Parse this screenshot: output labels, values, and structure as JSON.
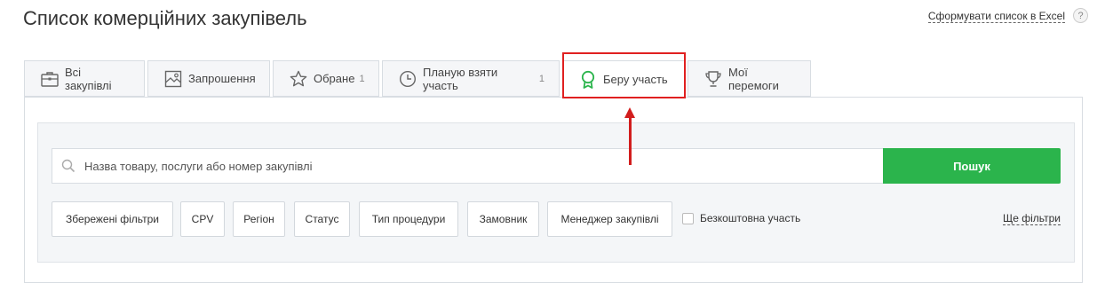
{
  "header": {
    "title": "Список комерційних закупівель",
    "excel_link": "Сформувати список в Excel",
    "help": "?"
  },
  "tabs": [
    {
      "label": "Всі закупівлі",
      "count": "",
      "icon": "briefcase-icon"
    },
    {
      "label": "Запрошення",
      "count": "",
      "icon": "envelope-icon"
    },
    {
      "label": "Обране",
      "count": "1",
      "icon": "star-icon"
    },
    {
      "label": "Планую взяти участь",
      "count": "1",
      "icon": "clock-icon"
    },
    {
      "label": "Беру участь",
      "count": "",
      "icon": "ribbon-badge-icon",
      "active": true
    },
    {
      "label": "Мої перемоги",
      "count": "",
      "icon": "trophy-icon"
    }
  ],
  "search": {
    "placeholder": "Назва товару, послуги або номер закупівлі",
    "value": "",
    "button": "Пошук"
  },
  "filters": {
    "saved": "Збережені фільтри",
    "cpv": "CPV",
    "region": "Регіон",
    "status": "Статус",
    "procedure_type": "Тип процедури",
    "customer": "Замовник",
    "manager": "Менеджер закупівлі",
    "free_participation": "Безкоштовна участь",
    "more": "Ще фільтри"
  },
  "colors": {
    "accent_green": "#2bb44c",
    "highlight_red": "#e02020"
  }
}
